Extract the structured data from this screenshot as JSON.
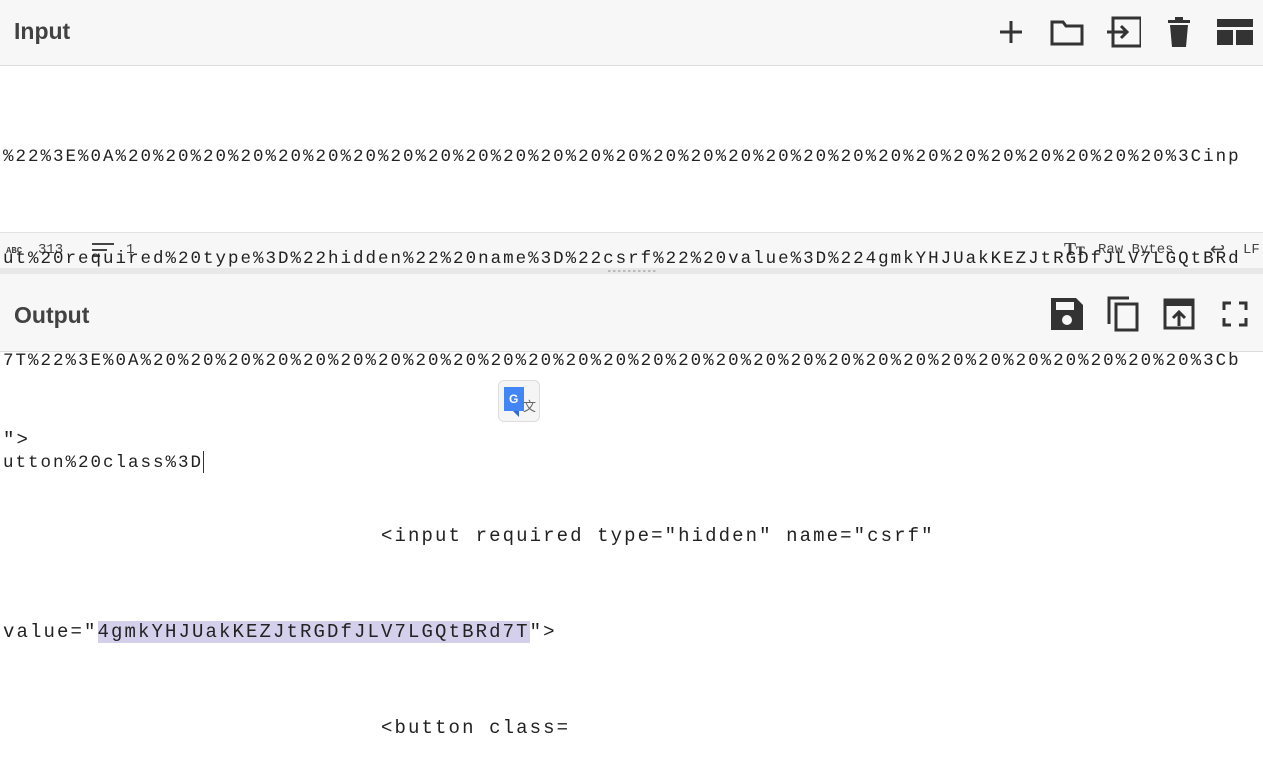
{
  "input": {
    "title": "Input",
    "icons": [
      "plus-icon",
      "folder-icon",
      "import-icon",
      "trash-icon",
      "layout-icon"
    ],
    "lines": [
      "%22%3E%0A%20%20%20%20%20%20%20%20%20%20%20%20%20%20%20%20%20%20%20%20%20%20%20%20%20%20%20%20%3Cinp",
      "ut%20required%20type%3D%22hidden%22%20name%3D%22csrf%22%20value%3D%224gmkYHJUakKEZJtRGDfJLV7LGQtBRd",
      "7T%22%3E%0A%20%20%20%20%20%20%20%20%20%20%20%20%20%20%20%20%20%20%20%20%20%20%20%20%20%20%20%20%3Cb",
      "utton%20class%3D"
    ],
    "status": {
      "length": "313",
      "lines": "1",
      "encoding": "Raw Bytes",
      "eol": "LF"
    }
  },
  "output": {
    "title": "Output",
    "icons": [
      "save-icon",
      "copy-icon",
      "replace-input-icon",
      "fullscreen-icon"
    ],
    "line1": "\">",
    "line2": "                            <input required type=\"hidden\" name=\"csrf\"",
    "line3_pre": "value=\"",
    "line3_sel": "4gmkYHJUakKEZJtRGDfJLV7LGQtBRd7T",
    "line3_post": "\">",
    "line4": "                            <button class="
  }
}
